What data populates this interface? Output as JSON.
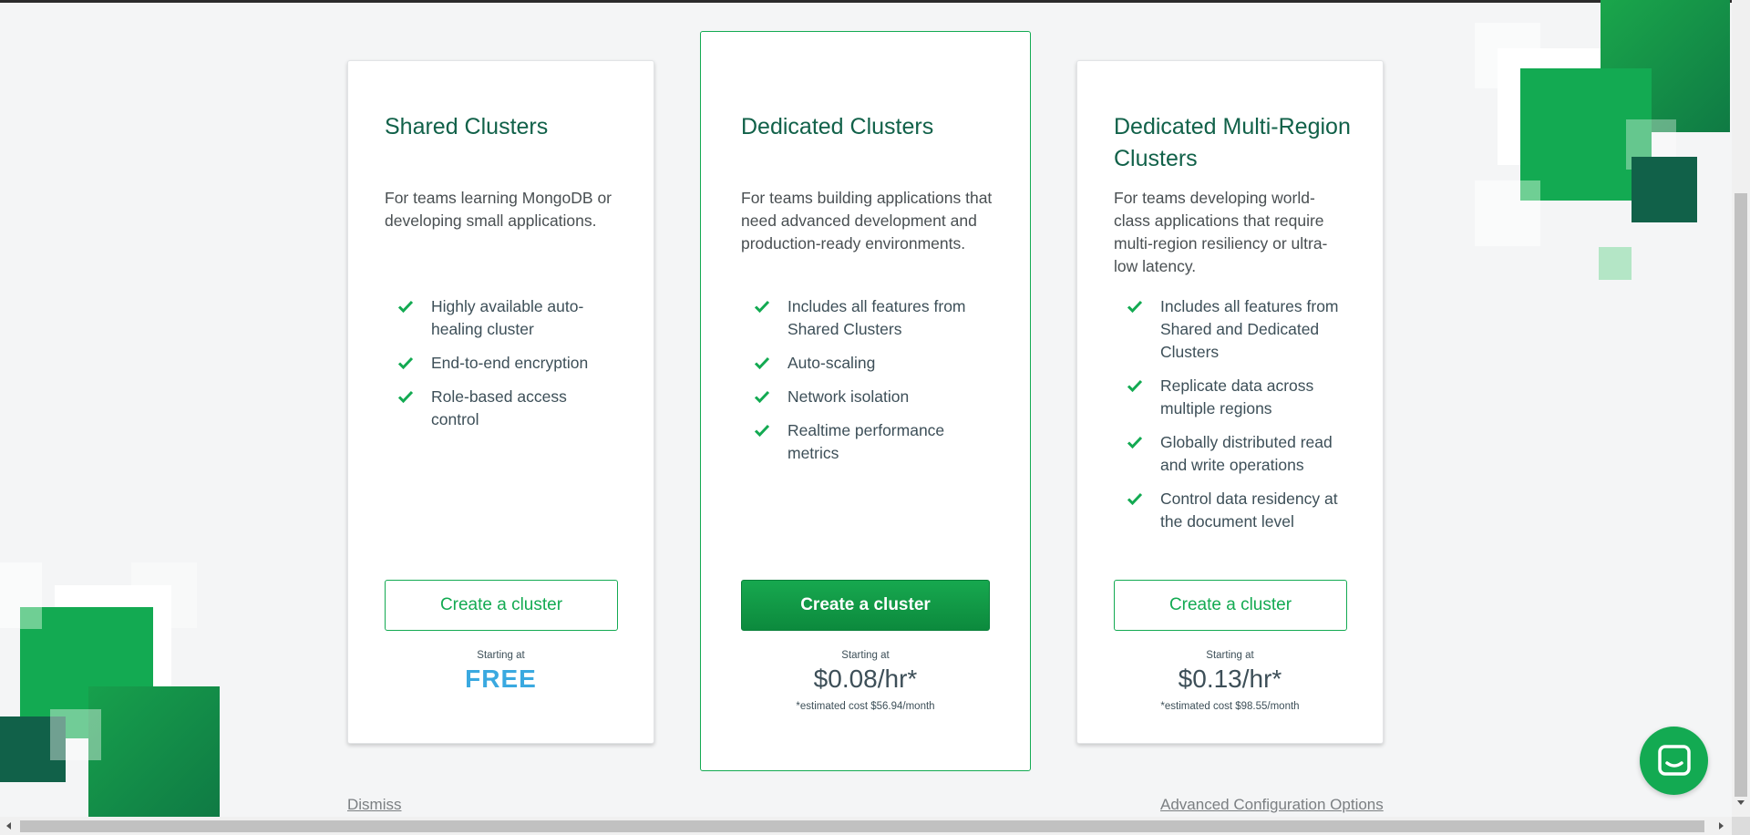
{
  "colors": {
    "brand_green": "#13aa52",
    "title_green": "#116149",
    "free_blue": "#3aa9e0",
    "background": "#f4f5f6"
  },
  "icons": {
    "feature_check": "check-icon",
    "chat": "chat-bubble-icon"
  },
  "cards": [
    {
      "title": "Shared Clusters",
      "description": "For teams learning MongoDB or developing small applications.",
      "features": [
        "Highly available auto-healing cluster",
        "End-to-end encryption",
        "Role-based access control"
      ],
      "button_label": "Create a cluster",
      "starting_label": "Starting at",
      "price": "FREE",
      "estimate": ""
    },
    {
      "title": "Dedicated Clusters",
      "description": "For teams building applications that need advanced development and production-ready environments.",
      "features": [
        "Includes all features from Shared Clusters",
        "Auto-scaling",
        "Network isolation",
        "Realtime performance metrics"
      ],
      "button_label": "Create a cluster",
      "starting_label": "Starting at",
      "price": "$0.08/hr*",
      "estimate": "*estimated cost $56.94/month"
    },
    {
      "title": "Dedicated Multi-Region Clusters",
      "description": "For teams developing world-class applications that require multi-region resiliency or ultra-low latency.",
      "features": [
        "Includes all features from Shared and Dedicated Clusters",
        "Replicate data across multiple regions",
        "Globally distributed read and write operations",
        "Control data residency at the document level"
      ],
      "button_label": "Create a cluster",
      "starting_label": "Starting at",
      "price": "$0.13/hr*",
      "estimate": "*estimated cost $98.55/month"
    }
  ],
  "footer": {
    "dismiss_label": "Dismiss",
    "advanced_label": "Advanced Configuration Options"
  }
}
